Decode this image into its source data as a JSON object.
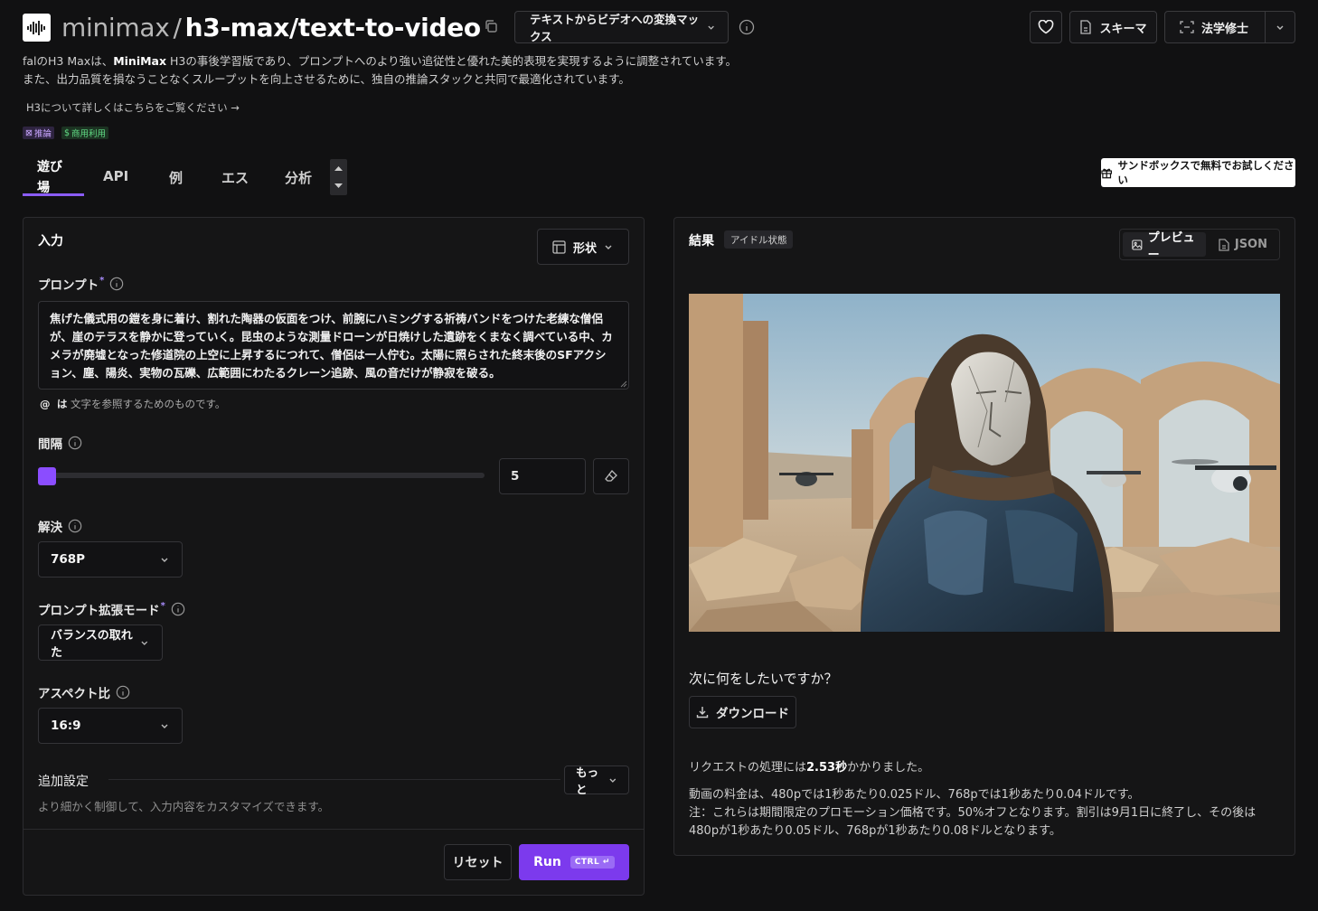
{
  "header": {
    "org": "minimax",
    "separator": "/",
    "model_name": "h3-max/text-to-video",
    "model_select": "テキストからビデオへの変換マックス",
    "schema_label": "スキーマ",
    "account_label": "法学修士"
  },
  "description": {
    "line1_pre": "falのH3 Maxは、",
    "line1_bold": "MiniMax",
    "line1_post": " H3の事後学習版であり、プロンプトへのより強い追従性と優れた美的表現を実現するように調整されています。",
    "line2": "また、出力品質を損なうことなくスループットを向上させるために、独自の推論スタックと共同で最適化されています。",
    "learn_more": "H3について詳しくはこちらをご覧ください →"
  },
  "badges": [
    "推論",
    "商用利用"
  ],
  "tabs": [
    {
      "label": "遊び場",
      "label_1": "遊び",
      "label_2": "場"
    },
    {
      "label": "API"
    },
    {
      "label": "例"
    },
    {
      "label": "エス"
    },
    {
      "label": "分析"
    }
  ],
  "sandbox_button": "サンドボックスで無料でお試しください",
  "input_panel": {
    "title": "入力",
    "form_button": "形状",
    "prompt_label": "プロンプト",
    "prompt_value": "焦げた儀式用の鎧を身に着け、割れた陶器の仮面をつけ、前腕にハミングする祈祷バンドをつけた老練な僧侶が、崖のテラスを静かに登っていく。昆虫のような測量ドローンが日焼けした遺跡をくまなく調べている中、カメラが廃墟となった修道院の上空に上昇するにつれて、僧侶は一人佇む。太陽に照らされた終末後のSFアクション、塵、陽炎、実物の瓦礫、広範囲にわたるクレーン追跡、風の音だけが静寂を破る。",
    "hint_at": "@",
    "hint_wa": "は",
    "hint_rest": " 文字を参照するためのものです。",
    "duration_label": "間隔",
    "duration_value": "5",
    "duration_fraction": 0.0,
    "resolution_label": "解決",
    "resolution_value": "768P",
    "prompt_mode_label": "プロンプト拡張モード",
    "prompt_mode_value": "バランスの取れた",
    "aspect_label": "アスペクト比",
    "aspect_value": "16:9",
    "advanced_label": "追加設定",
    "advanced_sub": "より細かく制御して、入力内容をカスタマイズできます。",
    "more_button": "もっと",
    "reset_button": "リセット",
    "run_button": "Run",
    "run_kbd": "CTRL ↵"
  },
  "result_panel": {
    "title": "結果",
    "status": "アイドル状態",
    "preview_tab": "プレビュー",
    "json_tab": "JSON",
    "next_question": "次に何をしたいですか？",
    "download": "ダウンロード",
    "req_pre": "リクエストの処理には",
    "req_time": "2.53秒",
    "req_post": "かかりました。",
    "price_line1": "動画の料金は、480pでは1秒あたり0.025ドル、768pでは1秒あたり0.04ドルです。",
    "price_line2": "注：これらは期間限定のプロモーション価格です。50%オフとなります。割引は9月1日に終了し、その後は480pが1秒あたり0.05ドル、768pが1秒あたり0.08ドルとなります。"
  },
  "colors": {
    "accent": "#7c3aed",
    "slider": "#8b4dff",
    "background": "#111112",
    "panel": "#151516"
  }
}
